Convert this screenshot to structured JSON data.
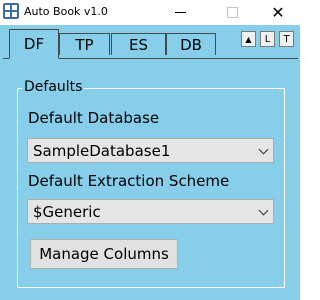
{
  "window": {
    "title": "Auto Book v1.0",
    "minimize_glyph": "—",
    "maximize_glyph": "☐",
    "close_glyph": "✕"
  },
  "tabs": [
    {
      "label": "DF",
      "active": true
    },
    {
      "label": "TP",
      "active": false
    },
    {
      "label": "ES",
      "active": false
    },
    {
      "label": "DB",
      "active": false
    }
  ],
  "small_buttons": {
    "up": "▲",
    "l": "L",
    "t": "T"
  },
  "defaults": {
    "group_label": "Defaults",
    "database_label": "Default Database",
    "database_value": "SampleDatabase1",
    "extraction_label": "Default Extraction Scheme",
    "extraction_value": "$Generic",
    "manage_columns_label": "Manage Columns"
  },
  "colors": {
    "background": "#87ceeb",
    "titlebar": "#ffffff",
    "group_border": "#ffffff",
    "combo_bg": "#e5e5e5",
    "button_bg": "#e1e1e1"
  }
}
